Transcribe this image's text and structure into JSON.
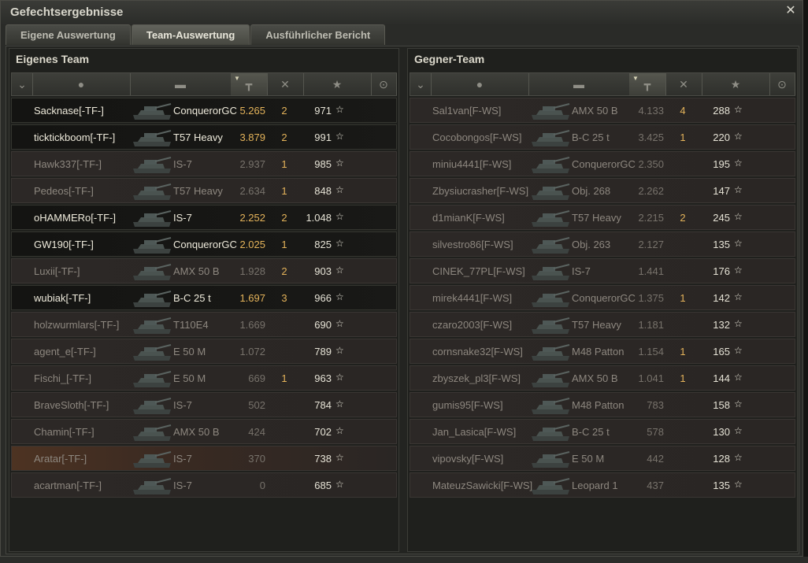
{
  "window": {
    "title": "Gefechtsergebnisse",
    "close_icon": "close-icon"
  },
  "tabs": [
    {
      "label": "Eigene Auswertung",
      "active": false
    },
    {
      "label": "Team-Auswertung",
      "active": true
    },
    {
      "label": "Ausführlicher Bericht",
      "active": false
    }
  ],
  "columns": [
    {
      "name": "rank-column",
      "icon": "chevron-rank-icon",
      "glyph": "⌄"
    },
    {
      "name": "player-column",
      "icon": "person-icon",
      "glyph": "●"
    },
    {
      "name": "tank-column",
      "icon": "tank-icon",
      "glyph": "▬"
    },
    {
      "name": "damage-column",
      "icon": "gun-icon",
      "glyph": "┳",
      "sorted": true
    },
    {
      "name": "kills-column",
      "icon": "destroyed-tank-icon",
      "glyph": "✕"
    },
    {
      "name": "xp-column",
      "icon": "star-icon",
      "glyph": "★"
    },
    {
      "name": "medal-column",
      "icon": "medal-icon",
      "glyph": "⊙"
    }
  ],
  "own_team": {
    "title": "Eigenes Team",
    "rows": [
      {
        "player": "Sacknase[-TF-]",
        "tank": "ConquerorGC",
        "damage": "5.265",
        "kills": "2",
        "xp": "971",
        "alive": true
      },
      {
        "player": "ticktickboom[-TF-]",
        "tank": "T57 Heavy",
        "damage": "3.879",
        "kills": "2",
        "xp": "991",
        "alive": true
      },
      {
        "player": "Hawk337[-TF-]",
        "tank": "IS-7",
        "damage": "2.937",
        "kills": "1",
        "xp": "985",
        "alive": false
      },
      {
        "player": "Pedeos[-TF-]",
        "tank": "T57 Heavy",
        "damage": "2.634",
        "kills": "1",
        "xp": "848",
        "alive": false
      },
      {
        "player": "oHAMMERo[-TF-]",
        "tank": "IS-7",
        "damage": "2.252",
        "kills": "2",
        "xp": "1.048",
        "alive": true
      },
      {
        "player": "GW190[-TF-]",
        "tank": "ConquerorGC",
        "damage": "2.025",
        "kills": "1",
        "xp": "825",
        "alive": true
      },
      {
        "player": "Luxii[-TF-]",
        "tank": "AMX 50 B",
        "damage": "1.928",
        "kills": "2",
        "xp": "903",
        "alive": false
      },
      {
        "player": "wubiak[-TF-]",
        "tank": "B-C 25 t",
        "damage": "1.697",
        "kills": "3",
        "xp": "966",
        "alive": true
      },
      {
        "player": "holzwurmlars[-TF-]",
        "tank": "T110E4",
        "damage": "1.669",
        "kills": "",
        "xp": "690",
        "alive": false
      },
      {
        "player": "agent_e[-TF-]",
        "tank": "E 50 M",
        "damage": "1.072",
        "kills": "",
        "xp": "789",
        "alive": false
      },
      {
        "player": "Fischi_[-TF-]",
        "tank": "E 50 M",
        "damage": "669",
        "kills": "1",
        "xp": "963",
        "alive": false
      },
      {
        "player": "BraveSloth[-TF-]",
        "tank": "IS-7",
        "damage": "502",
        "kills": "",
        "xp": "784",
        "alive": false
      },
      {
        "player": "Chamin[-TF-]",
        "tank": "AMX 50 B",
        "damage": "424",
        "kills": "",
        "xp": "702",
        "alive": false
      },
      {
        "player": "Aratar[-TF-]",
        "tank": "IS-7",
        "damage": "370",
        "kills": "",
        "xp": "738",
        "alive": false,
        "highlight": true
      },
      {
        "player": "acartman[-TF-]",
        "tank": "IS-7",
        "damage": "0",
        "kills": "",
        "xp": "685",
        "alive": false
      }
    ]
  },
  "enemy_team": {
    "title": "Gegner-Team",
    "rows": [
      {
        "player": "Sal1van[F-WS]",
        "tank": "AMX 50 B",
        "damage": "4.133",
        "kills": "4",
        "xp": "288",
        "alive": false
      },
      {
        "player": "Cocobongos[F-WS]",
        "tank": "B-C 25 t",
        "damage": "3.425",
        "kills": "1",
        "xp": "220",
        "alive": false
      },
      {
        "player": "miniu4441[F-WS]",
        "tank": "ConquerorGC",
        "damage": "2.350",
        "kills": "",
        "xp": "195",
        "alive": false
      },
      {
        "player": "Zbysiucrasher[F-WS]",
        "tank": "Obj. 268",
        "damage": "2.262",
        "kills": "",
        "xp": "147",
        "alive": false
      },
      {
        "player": "d1mianK[F-WS]",
        "tank": "T57 Heavy",
        "damage": "2.215",
        "kills": "2",
        "xp": "245",
        "alive": false
      },
      {
        "player": "silvestro86[F-WS]",
        "tank": "Obj. 263",
        "damage": "2.127",
        "kills": "",
        "xp": "135",
        "alive": false
      },
      {
        "player": "CINEK_77PL[F-WS]",
        "tank": "IS-7",
        "damage": "1.441",
        "kills": "",
        "xp": "176",
        "alive": false
      },
      {
        "player": "mirek4441[F-WS]",
        "tank": "ConquerorGC",
        "damage": "1.375",
        "kills": "1",
        "xp": "142",
        "alive": false
      },
      {
        "player": "czaro2003[F-WS]",
        "tank": "T57 Heavy",
        "damage": "1.181",
        "kills": "",
        "xp": "132",
        "alive": false
      },
      {
        "player": "cornsnake32[F-WS]",
        "tank": "M48 Patton",
        "damage": "1.154",
        "kills": "1",
        "xp": "165",
        "alive": false
      },
      {
        "player": "zbyszek_pl3[F-WS]",
        "tank": "AMX 50 B",
        "damage": "1.041",
        "kills": "1",
        "xp": "144",
        "alive": false
      },
      {
        "player": "gumis95[F-WS]",
        "tank": "M48 Patton",
        "damage": "783",
        "kills": "",
        "xp": "158",
        "alive": false
      },
      {
        "player": "Jan_Lasica[F-WS]",
        "tank": "B-C 25 t",
        "damage": "578",
        "kills": "",
        "xp": "130",
        "alive": false
      },
      {
        "player": "vipovsky[F-WS]",
        "tank": "E 50 M",
        "damage": "442",
        "kills": "",
        "xp": "128",
        "alive": false
      },
      {
        "player": "MateuzSawicki[F-WS]",
        "tank": "Leopard 1",
        "damage": "437",
        "kills": "",
        "xp": "135",
        "alive": false
      }
    ]
  },
  "colors": {
    "alive_text": "#eeeadb",
    "dead_text": "#8d877f",
    "damage_accent": "#e4b35a"
  }
}
